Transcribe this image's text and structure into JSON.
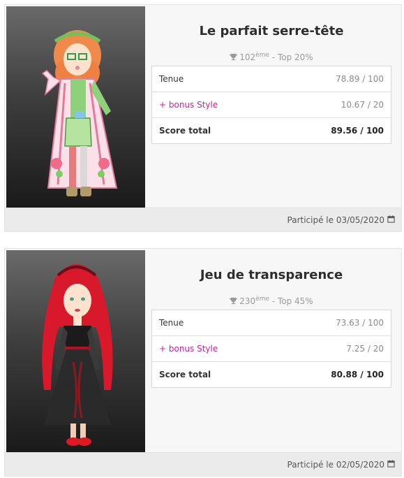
{
  "participations": [
    {
      "contest_title": "Le parfait serre-tête",
      "rank_number": "102",
      "rank_suffix": "ème",
      "rank_top": " - Top 20%",
      "tenue_label": "Tenue",
      "tenue_value": "78.89 / 100",
      "bonus_label": "+ bonus Style",
      "bonus_value": "10.67 / 20",
      "total_label": "Score total",
      "total_value": "89.56 / 100",
      "participation_date": "Participé le 03/05/2020"
    },
    {
      "contest_title": "Jeu de transparence",
      "rank_number": "230",
      "rank_suffix": "ème",
      "rank_top": " - Top 45%",
      "tenue_label": "Tenue",
      "tenue_value": "73.63 / 100",
      "bonus_label": "+ bonus Style",
      "bonus_value": "7.25 / 20",
      "total_label": "Score total",
      "total_value": "80.88 / 100",
      "participation_date": "Participé le 02/05/2020"
    }
  ],
  "icons": {
    "rank": "trophy-icon",
    "date": "calendar-icon"
  },
  "colors": {
    "bonus": "#e0189a",
    "card_bg": "#f7f7f7",
    "footer_bg": "#ebebeb"
  }
}
